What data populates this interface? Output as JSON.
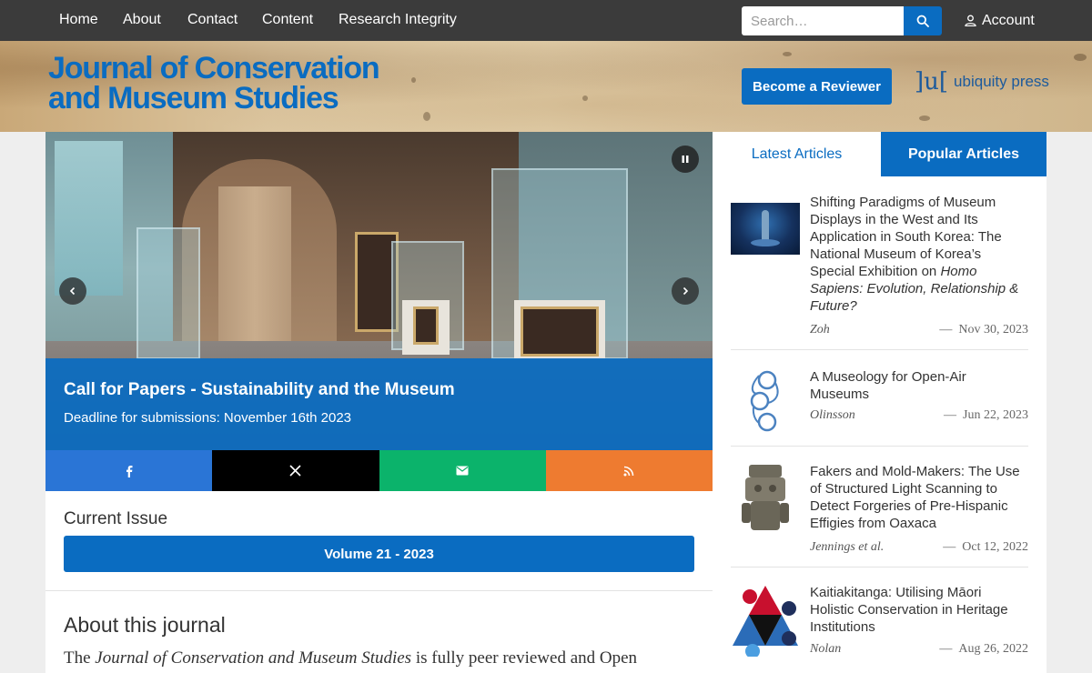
{
  "nav": {
    "links": [
      "Home",
      "About",
      "Contact",
      "Content",
      "Research Integrity"
    ],
    "search_placeholder": "Search…",
    "account_label": "Account"
  },
  "header": {
    "journal_title_line1": "Journal of Conservation",
    "journal_title_line2": "and Museum Studies",
    "reviewer_button": "Become a Reviewer",
    "publisher_mark": "]u[",
    "publisher_name": "ubiquity press"
  },
  "slider": {
    "caption_title": "Call for Papers - Sustainability and the Museum",
    "caption_subtitle": "Deadline for submissions: November 16th 2023"
  },
  "share": [
    {
      "icon": "facebook-icon",
      "color": "#2a75d6"
    },
    {
      "icon": "x-icon",
      "color": "#000000"
    },
    {
      "icon": "email-icon",
      "color": "#0bb36b"
    },
    {
      "icon": "rss-icon",
      "color": "#ee7b30"
    }
  ],
  "current_issue": {
    "heading": "Current Issue",
    "volume_label": "Volume 21 - 2023"
  },
  "about": {
    "heading": "About this journal",
    "text_prefix": "The ",
    "text_italic": "Journal of Conservation and Museum Studies",
    "text_suffix": " is fully peer reviewed and Open"
  },
  "sidebar": {
    "tabs": {
      "latest": "Latest Articles",
      "popular": "Popular Articles"
    },
    "articles": [
      {
        "title_line1": "Shifting Paradigms of Museum",
        "title_line2": "Displays in the West and Its",
        "title_line3": "Application in South Korea: The",
        "title_line4": "National Museum of Korea’s",
        "title_line5": "Special Exhibition on ",
        "title_italic_a": "Homo",
        "title_italic_b": "Sapiens: Evolution, Relationship &",
        "title_italic_c": "Future?",
        "author": "Zoh",
        "date": "Nov 30, 2023"
      },
      {
        "title_line1": "A Museology for Open-Air",
        "title_line2": "Museums",
        "author": "Olinsson",
        "date": "Jun 22, 2023"
      },
      {
        "title_line1": "Fakers and Mold-Makers: The Use",
        "title_line2": "of Structured Light Scanning to",
        "title_line3": "Detect Forgeries of Pre-Hispanic",
        "title_line4": "Effigies from Oaxaca",
        "author": "Jennings et al.",
        "date": "Oct 12, 2022"
      },
      {
        "title_line1": "Kaitiakitanga: Utilising Māori",
        "title_line2": "Holistic Conservation in Heritage",
        "title_line3": "Institutions",
        "author": "Nolan",
        "date": "Aug 26, 2022"
      }
    ]
  }
}
